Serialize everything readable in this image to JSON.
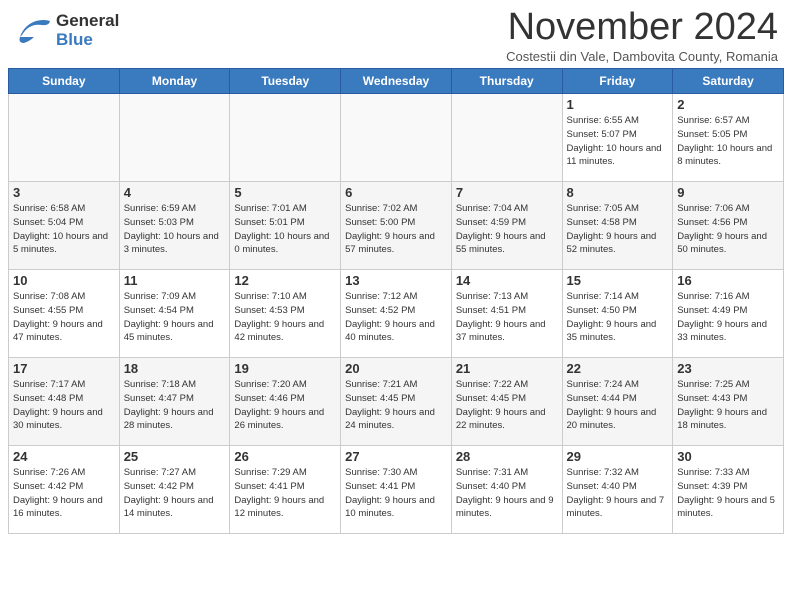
{
  "header": {
    "logo_general": "General",
    "logo_blue": "Blue",
    "month_title": "November 2024",
    "location": "Costestii din Vale, Dambovita County, Romania"
  },
  "days_of_week": [
    "Sunday",
    "Monday",
    "Tuesday",
    "Wednesday",
    "Thursday",
    "Friday",
    "Saturday"
  ],
  "weeks": [
    [
      {
        "day": "",
        "info": ""
      },
      {
        "day": "",
        "info": ""
      },
      {
        "day": "",
        "info": ""
      },
      {
        "day": "",
        "info": ""
      },
      {
        "day": "",
        "info": ""
      },
      {
        "day": "1",
        "info": "Sunrise: 6:55 AM\nSunset: 5:07 PM\nDaylight: 10 hours and 11 minutes."
      },
      {
        "day": "2",
        "info": "Sunrise: 6:57 AM\nSunset: 5:05 PM\nDaylight: 10 hours and 8 minutes."
      }
    ],
    [
      {
        "day": "3",
        "info": "Sunrise: 6:58 AM\nSunset: 5:04 PM\nDaylight: 10 hours and 5 minutes."
      },
      {
        "day": "4",
        "info": "Sunrise: 6:59 AM\nSunset: 5:03 PM\nDaylight: 10 hours and 3 minutes."
      },
      {
        "day": "5",
        "info": "Sunrise: 7:01 AM\nSunset: 5:01 PM\nDaylight: 10 hours and 0 minutes."
      },
      {
        "day": "6",
        "info": "Sunrise: 7:02 AM\nSunset: 5:00 PM\nDaylight: 9 hours and 57 minutes."
      },
      {
        "day": "7",
        "info": "Sunrise: 7:04 AM\nSunset: 4:59 PM\nDaylight: 9 hours and 55 minutes."
      },
      {
        "day": "8",
        "info": "Sunrise: 7:05 AM\nSunset: 4:58 PM\nDaylight: 9 hours and 52 minutes."
      },
      {
        "day": "9",
        "info": "Sunrise: 7:06 AM\nSunset: 4:56 PM\nDaylight: 9 hours and 50 minutes."
      }
    ],
    [
      {
        "day": "10",
        "info": "Sunrise: 7:08 AM\nSunset: 4:55 PM\nDaylight: 9 hours and 47 minutes."
      },
      {
        "day": "11",
        "info": "Sunrise: 7:09 AM\nSunset: 4:54 PM\nDaylight: 9 hours and 45 minutes."
      },
      {
        "day": "12",
        "info": "Sunrise: 7:10 AM\nSunset: 4:53 PM\nDaylight: 9 hours and 42 minutes."
      },
      {
        "day": "13",
        "info": "Sunrise: 7:12 AM\nSunset: 4:52 PM\nDaylight: 9 hours and 40 minutes."
      },
      {
        "day": "14",
        "info": "Sunrise: 7:13 AM\nSunset: 4:51 PM\nDaylight: 9 hours and 37 minutes."
      },
      {
        "day": "15",
        "info": "Sunrise: 7:14 AM\nSunset: 4:50 PM\nDaylight: 9 hours and 35 minutes."
      },
      {
        "day": "16",
        "info": "Sunrise: 7:16 AM\nSunset: 4:49 PM\nDaylight: 9 hours and 33 minutes."
      }
    ],
    [
      {
        "day": "17",
        "info": "Sunrise: 7:17 AM\nSunset: 4:48 PM\nDaylight: 9 hours and 30 minutes."
      },
      {
        "day": "18",
        "info": "Sunrise: 7:18 AM\nSunset: 4:47 PM\nDaylight: 9 hours and 28 minutes."
      },
      {
        "day": "19",
        "info": "Sunrise: 7:20 AM\nSunset: 4:46 PM\nDaylight: 9 hours and 26 minutes."
      },
      {
        "day": "20",
        "info": "Sunrise: 7:21 AM\nSunset: 4:45 PM\nDaylight: 9 hours and 24 minutes."
      },
      {
        "day": "21",
        "info": "Sunrise: 7:22 AM\nSunset: 4:45 PM\nDaylight: 9 hours and 22 minutes."
      },
      {
        "day": "22",
        "info": "Sunrise: 7:24 AM\nSunset: 4:44 PM\nDaylight: 9 hours and 20 minutes."
      },
      {
        "day": "23",
        "info": "Sunrise: 7:25 AM\nSunset: 4:43 PM\nDaylight: 9 hours and 18 minutes."
      }
    ],
    [
      {
        "day": "24",
        "info": "Sunrise: 7:26 AM\nSunset: 4:42 PM\nDaylight: 9 hours and 16 minutes."
      },
      {
        "day": "25",
        "info": "Sunrise: 7:27 AM\nSunset: 4:42 PM\nDaylight: 9 hours and 14 minutes."
      },
      {
        "day": "26",
        "info": "Sunrise: 7:29 AM\nSunset: 4:41 PM\nDaylight: 9 hours and 12 minutes."
      },
      {
        "day": "27",
        "info": "Sunrise: 7:30 AM\nSunset: 4:41 PM\nDaylight: 9 hours and 10 minutes."
      },
      {
        "day": "28",
        "info": "Sunrise: 7:31 AM\nSunset: 4:40 PM\nDaylight: 9 hours and 9 minutes."
      },
      {
        "day": "29",
        "info": "Sunrise: 7:32 AM\nSunset: 4:40 PM\nDaylight: 9 hours and 7 minutes."
      },
      {
        "day": "30",
        "info": "Sunrise: 7:33 AM\nSunset: 4:39 PM\nDaylight: 9 hours and 5 minutes."
      }
    ]
  ]
}
